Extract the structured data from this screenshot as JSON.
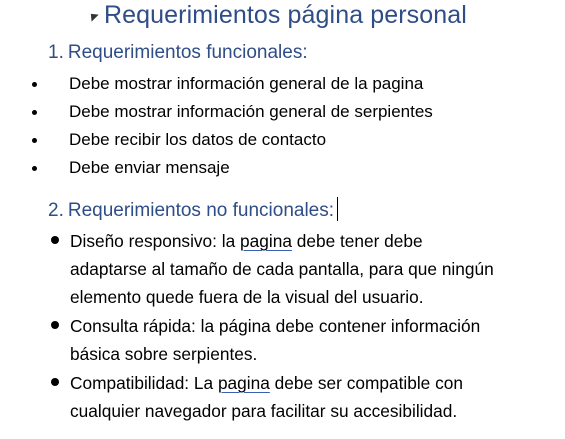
{
  "heading": "Requerimientos página personal",
  "section1": {
    "number": "1.",
    "title": "Requerimientos funcionales:",
    "items": [
      "Debe mostrar información general de la pagina",
      "Debe mostrar información general de serpientes",
      "Debe recibir los datos de contacto",
      "Debe enviar mensaje"
    ]
  },
  "section2": {
    "number": "2.",
    "title": "Requerimientos no funcionales:",
    "items": [
      {
        "lines": [
          {
            "pre": " Diseño responsivo: la ",
            "ul": "pagina",
            "post": " debe tener debe"
          },
          {
            "pre": "adaptarse al tamaño de cada pantalla, para que ningún",
            "ul": "",
            "post": ""
          },
          {
            "pre": "elemento quede fuera de la visual del usuario.",
            "ul": "",
            "post": ""
          }
        ]
      },
      {
        "lines": [
          {
            "pre": "Consulta rápida: la página debe contener información",
            "ul": "",
            "post": ""
          },
          {
            "pre": "básica sobre serpientes.",
            "ul": "",
            "post": ""
          }
        ]
      },
      {
        "lines": [
          {
            "pre": "Compatibilidad: La ",
            "ul": "pagina",
            "post": " debe ser compatible con"
          },
          {
            "pre": "cualquier navegador para facilitar su accesibilidad.",
            "ul": "",
            "post": ""
          }
        ]
      }
    ]
  }
}
